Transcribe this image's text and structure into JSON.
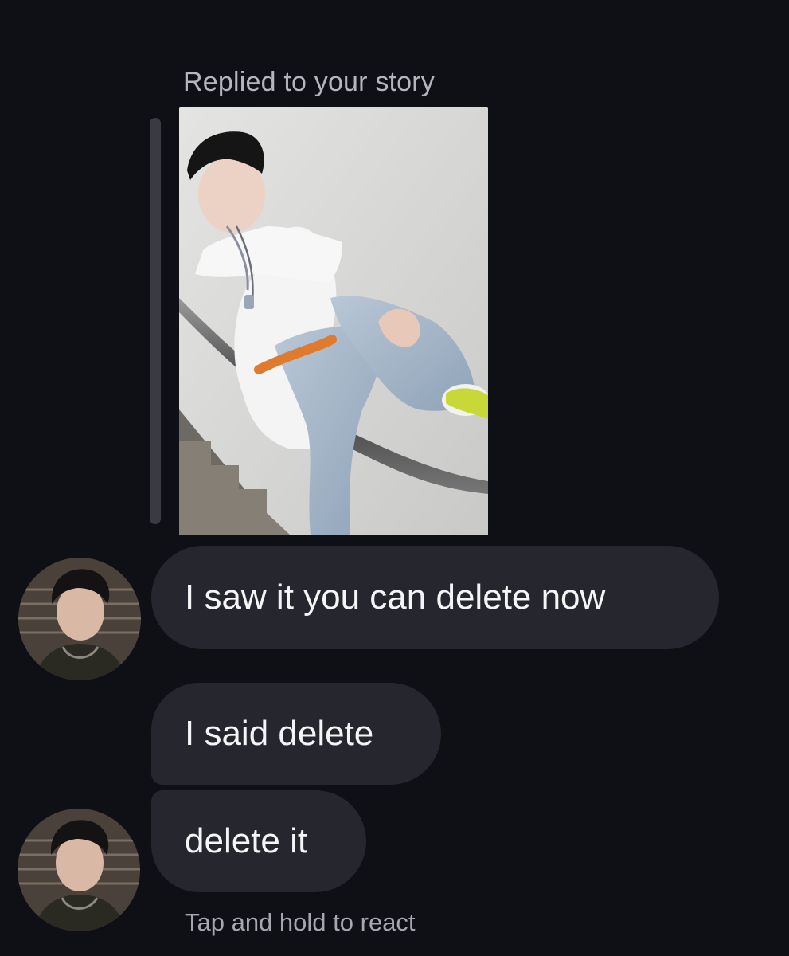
{
  "thread": {
    "reply_context": "Replied to your story",
    "story": {
      "thumbnail_icon": "story-photo"
    },
    "messages": [
      {
        "text": "I saw it you can delete now",
        "sender": "them"
      },
      {
        "text": "I said delete",
        "sender": "them"
      },
      {
        "text": "delete it",
        "sender": "them"
      }
    ],
    "reaction_hint": "Tap and hold to react"
  },
  "colors": {
    "background": "#0f1015",
    "bubble": "#26272e",
    "secondary_text": "#b5b5bd",
    "reply_bar": "#3a3b42"
  }
}
